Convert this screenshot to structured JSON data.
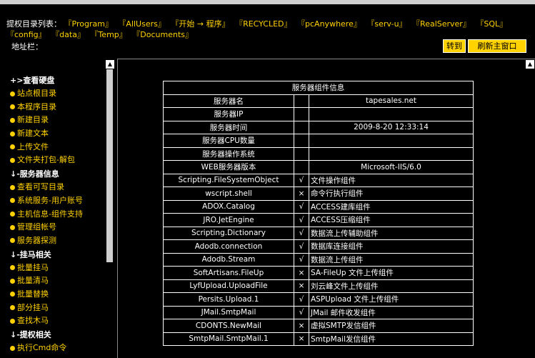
{
  "header": {
    "dirs_label": "提权目录列表：",
    "dirs": [
      "『Program』",
      "『AllUsers』",
      "『开始 → 程序』",
      "『RECYCLED』",
      "『pcAnywhere』",
      "『serv-u』",
      "『RealServer』",
      "『SQL』",
      "『config』",
      "『data』",
      "『Temp』",
      "『Documents』"
    ],
    "address_label": "地址栏：",
    "goto_label": "转到",
    "refresh_label": "刷新主窗口"
  },
  "sidebar": {
    "sections": [
      {
        "title": "+>查看硬盘",
        "items": [
          "站点根目录",
          "本程序目录",
          "新建目录",
          "新建文本",
          "上传文件",
          "文件夹打包-解包"
        ]
      },
      {
        "title": "↓-服务器信息",
        "items": [
          "查看可写目录",
          "系统服务-用户账号",
          "主机信息-组件支持",
          "管理组帐号",
          "服务器探测"
        ]
      },
      {
        "title": "↓-挂马相关",
        "items": [
          "批量挂马",
          "批量清马",
          "批量替换",
          "部分挂马",
          "查找木马"
        ]
      },
      {
        "title": "↓-提权相关",
        "items": [
          "执行Cmd命令"
        ]
      }
    ]
  },
  "table": {
    "title": "服务器组件信息",
    "info_rows": [
      {
        "name": "服务器名",
        "mark": "",
        "value": "tapesales.net"
      },
      {
        "name": "服务器IP",
        "mark": "",
        "value": ""
      },
      {
        "name": "服务器时间",
        "mark": "",
        "value": "2009-8-20 12:33:14"
      },
      {
        "name": "服务器CPU数量",
        "mark": "",
        "value": ""
      },
      {
        "name": "服务器操作系统",
        "mark": "",
        "value": ""
      },
      {
        "name": "WEB服务器版本",
        "mark": "",
        "value": "Microsoft-IIS/6.0"
      }
    ],
    "component_rows": [
      {
        "name": "Scripting.FileSystemObject",
        "mark": "√",
        "value": "文件操作组件"
      },
      {
        "name": "wscript.shell",
        "mark": "×",
        "value": "命令行执行组件"
      },
      {
        "name": "ADOX.Catalog",
        "mark": "√",
        "value": "ACCESS建库组件"
      },
      {
        "name": "JRO.JetEngine",
        "mark": "√",
        "value": "ACCESS压缩组件"
      },
      {
        "name": "Scripting.Dictionary",
        "mark": "√",
        "value": "数据流上传辅助组件"
      },
      {
        "name": "Adodb.connection",
        "mark": "√",
        "value": "数据库连接组件"
      },
      {
        "name": "Adodb.Stream",
        "mark": "√",
        "value": "数据流上传组件"
      },
      {
        "name": "SoftArtisans.FileUp",
        "mark": "×",
        "value": "SA-FileUp 文件上传组件"
      },
      {
        "name": "LyfUpload.UploadFile",
        "mark": "×",
        "value": "刘云峰文件上传组件"
      },
      {
        "name": "Persits.Upload.1",
        "mark": "√",
        "value": "ASPUpload 文件上传组件"
      },
      {
        "name": "JMail.SmtpMail",
        "mark": "√",
        "value": "JMail 邮件收发组件"
      },
      {
        "name": "CDONTS.NewMail",
        "mark": "×",
        "value": "虚拟SMTP发信组件"
      },
      {
        "name": "SmtpMail.SmtpMail.1",
        "mark": "×",
        "value": "SmtpMail发信组件"
      }
    ]
  },
  "colors": {
    "background": "#000000",
    "accent": "#ffd100",
    "text": "#ffffff"
  }
}
